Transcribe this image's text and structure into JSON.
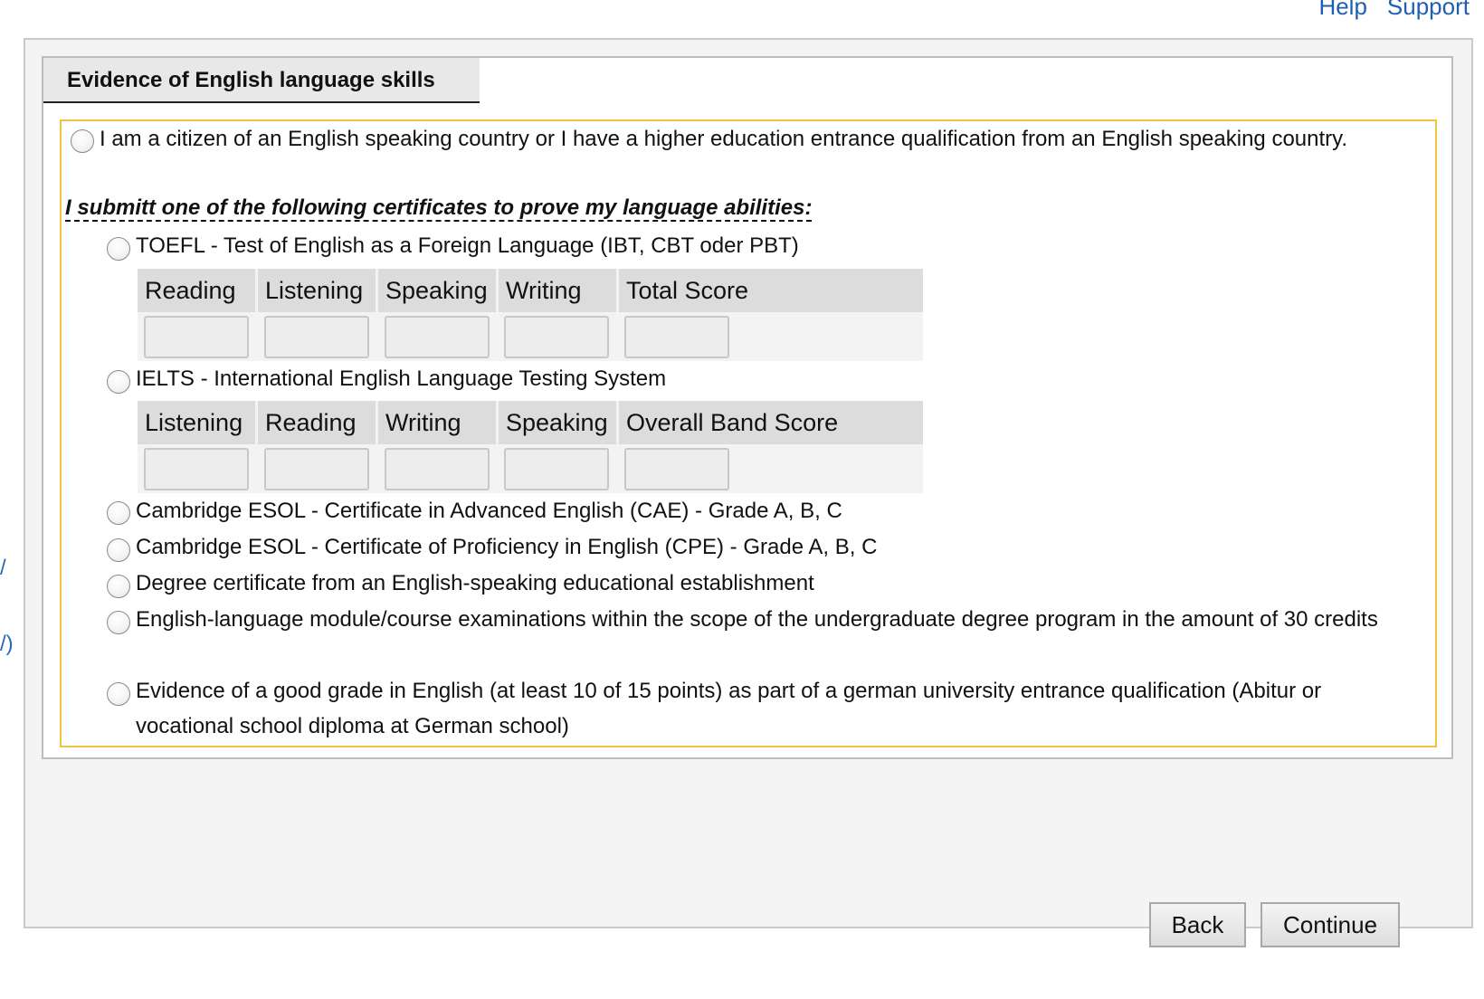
{
  "top_links": {
    "help": "Help",
    "support": "Support"
  },
  "left_fragments": [
    "/",
    "/)"
  ],
  "section": {
    "title": "Evidence of English language skills"
  },
  "options": {
    "citizen": "I am a citizen of an English speaking country or I have a higher education entrance qualification from an English speaking country.",
    "certificates_heading": "I submitt one of the following certificates to prove my language abilities:",
    "toefl": {
      "label": "TOEFL - Test of English as a Foreign Language (IBT, CBT oder PBT)",
      "columns": [
        "Reading",
        "Listening",
        "Speaking",
        "Writing",
        "Total Score"
      ],
      "values": [
        "",
        "",
        "",
        "",
        ""
      ]
    },
    "ielts": {
      "label": "IELTS - International English Language Testing System",
      "columns": [
        "Listening",
        "Reading",
        "Writing",
        "Speaking",
        "Overall Band Score"
      ],
      "values": [
        "",
        "",
        "",
        "",
        ""
      ]
    },
    "cae": "Cambridge ESOL - Certificate in Advanced English (CAE) - Grade A, B, C",
    "cpe": "Cambridge ESOL - Certificate of Proficiency in English (CPE) - Grade A, B, C",
    "degree": "Degree certificate from an English-speaking educational establishment",
    "module": "English-language module/course examinations within the scope of the undergraduate degree program in the amount of 30 credits",
    "grade": "Evidence of a good grade in English (at least 10 of 15 points) as part of a german university entrance qualification (Abitur or vocational school diploma at German school)"
  },
  "buttons": {
    "back": "Back",
    "continue": "Continue"
  }
}
